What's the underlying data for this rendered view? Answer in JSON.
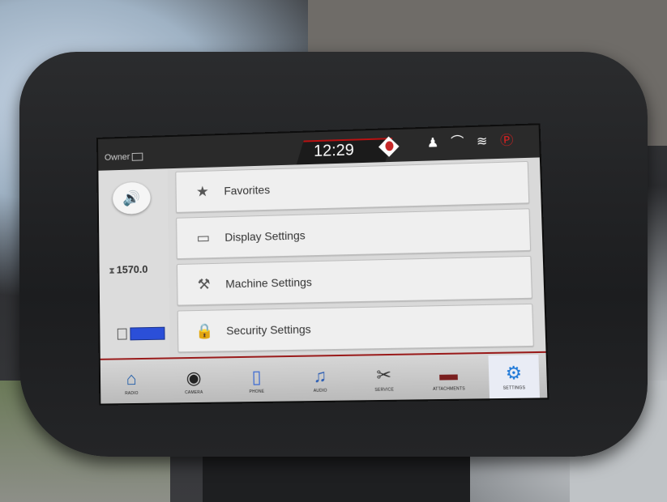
{
  "status": {
    "user_label": "Owner",
    "time": "12:29",
    "warning_icon": "warning-diamond-icon",
    "indicator_icons": [
      "operator-seat-icon",
      "loader-arms-icon",
      "engine-preheat-icon",
      "parking-brake-icon"
    ]
  },
  "left_panel": {
    "volume_icon": "speaker-icon",
    "hour_meter": "1570.0",
    "fuel_level": 1.0
  },
  "menu": {
    "items": [
      {
        "label": "Favorites",
        "icon": "star-icon"
      },
      {
        "label": "Display Settings",
        "icon": "display-icon"
      },
      {
        "label": "Machine Settings",
        "icon": "wrench-icon"
      },
      {
        "label": "Security Settings",
        "icon": "lock-icon"
      }
    ]
  },
  "nav": {
    "items": [
      {
        "label": "RADIO",
        "icon": "home-icon"
      },
      {
        "label": "CAMERA",
        "icon": "camera-icon"
      },
      {
        "label": "PHONE",
        "icon": "phone-icon"
      },
      {
        "label": "AUDIO",
        "icon": "audio-icon"
      },
      {
        "label": "SERVICE",
        "icon": "service-tools-icon"
      },
      {
        "label": "ATTACHMENTS",
        "icon": "attachment-bucket-icon"
      },
      {
        "label": "SETTINGS",
        "icon": "settings-gear-icon"
      }
    ],
    "active": "SETTINGS"
  },
  "colors": {
    "accent_red": "#b11111",
    "fuel_blue": "#2b4fd8",
    "warning_red": "#c62828"
  }
}
